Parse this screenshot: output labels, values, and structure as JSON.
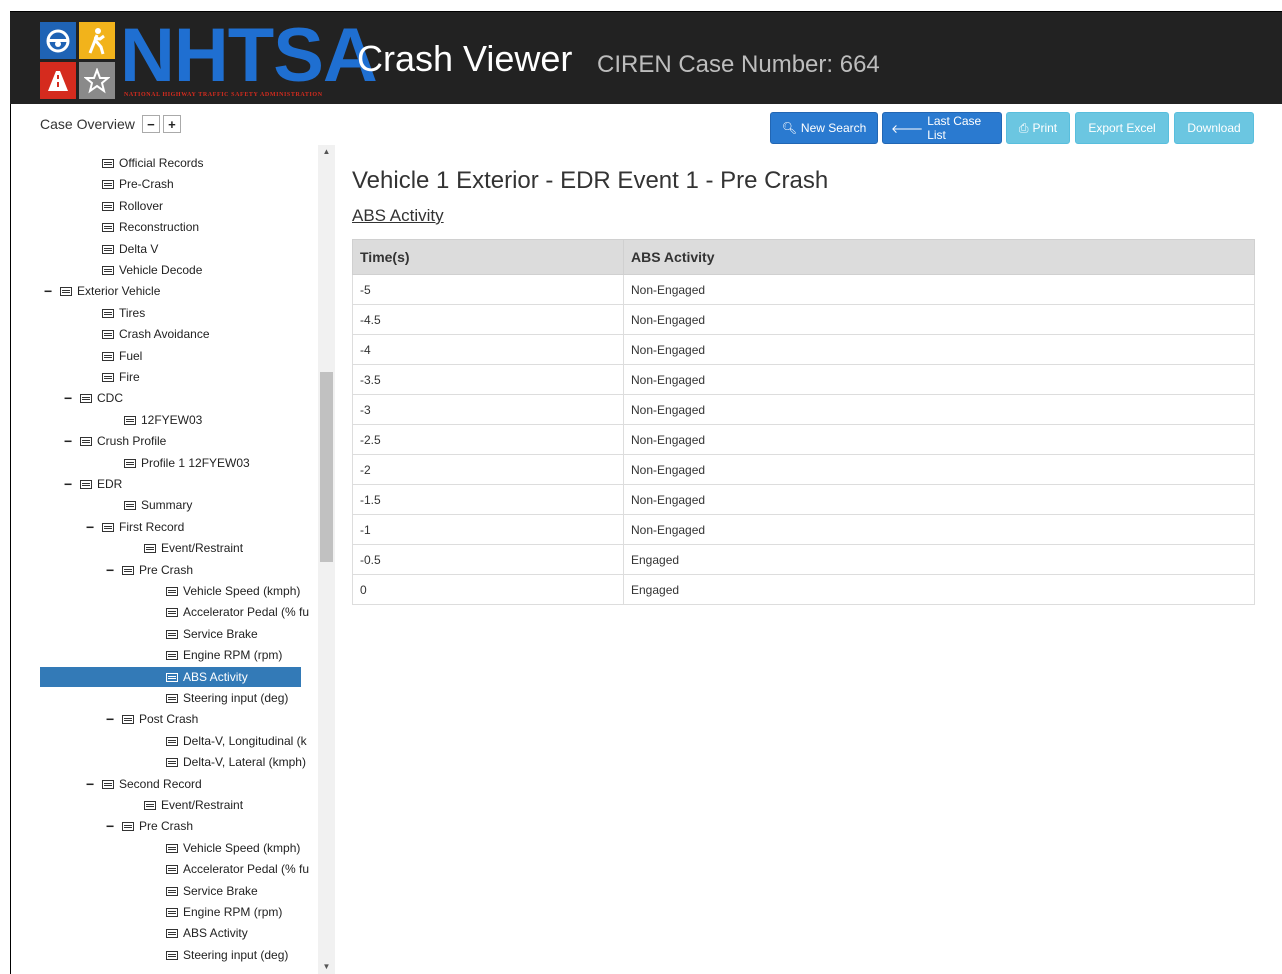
{
  "header": {
    "logo_text": "NHTSA",
    "logo_subtext": "NATIONAL HIGHWAY TRAFFIC SAFETY ADMINISTRATION",
    "app_title": "Crash Viewer",
    "case_label": "CIREN Case Number: 664"
  },
  "sidebar": {
    "title": "Case Overview",
    "collapse_label": "−",
    "expand_label": "+",
    "tree": [
      {
        "label": "Official Records",
        "toggle": ""
      },
      {
        "label": "Pre-Crash",
        "toggle": ""
      },
      {
        "label": "Rollover",
        "toggle": ""
      },
      {
        "label": "Reconstruction",
        "toggle": ""
      },
      {
        "label": "Delta V",
        "toggle": ""
      },
      {
        "label": "Vehicle Decode",
        "toggle": ""
      },
      {
        "label": "Exterior Vehicle",
        "toggle": "−"
      },
      {
        "label": "Tires",
        "toggle": ""
      },
      {
        "label": "Crash Avoidance",
        "toggle": ""
      },
      {
        "label": "Fuel",
        "toggle": ""
      },
      {
        "label": "Fire",
        "toggle": ""
      },
      {
        "label": "CDC",
        "toggle": "−"
      },
      {
        "label": "12FYEW03",
        "toggle": ""
      },
      {
        "label": "Crush Profile",
        "toggle": "−"
      },
      {
        "label": "Profile 1 12FYEW03",
        "toggle": ""
      },
      {
        "label": "EDR",
        "toggle": "−"
      },
      {
        "label": "Summary",
        "toggle": ""
      },
      {
        "label": "First Record",
        "toggle": "−"
      },
      {
        "label": "Event/Restraint",
        "toggle": ""
      },
      {
        "label": "Pre Crash",
        "toggle": "−"
      },
      {
        "label": "Vehicle Speed (kmph)",
        "toggle": ""
      },
      {
        "label": "Accelerator Pedal (% fu",
        "toggle": ""
      },
      {
        "label": "Service Brake",
        "toggle": ""
      },
      {
        "label": "Engine RPM (rpm)",
        "toggle": ""
      },
      {
        "label": "ABS Activity",
        "toggle": "",
        "selected": true
      },
      {
        "label": "Steering input (deg)",
        "toggle": ""
      },
      {
        "label": "Post Crash",
        "toggle": "−"
      },
      {
        "label": "Delta-V, Longitudinal (k",
        "toggle": ""
      },
      {
        "label": "Delta-V, Lateral (kmph)",
        "toggle": ""
      },
      {
        "label": "Second Record",
        "toggle": "−"
      },
      {
        "label": "Event/Restraint",
        "toggle": ""
      },
      {
        "label": "Pre Crash",
        "toggle": "−"
      },
      {
        "label": "Vehicle Speed (kmph)",
        "toggle": ""
      },
      {
        "label": "Accelerator Pedal (% fu",
        "toggle": ""
      },
      {
        "label": "Service Brake",
        "toggle": ""
      },
      {
        "label": "Engine RPM (rpm)",
        "toggle": ""
      },
      {
        "label": "ABS Activity",
        "toggle": ""
      },
      {
        "label": "Steering input (deg)",
        "toggle": ""
      }
    ]
  },
  "toolbar": {
    "new_search": "New Search",
    "last_case_list": "Last Case List",
    "print": "Print",
    "export_excel": "Export Excel",
    "download": "Download"
  },
  "main": {
    "title": "Vehicle 1 Exterior - EDR Event 1 - Pre Crash",
    "section": "ABS Activity",
    "table": {
      "headers": [
        "Time(s)",
        "ABS Activity"
      ],
      "rows": [
        [
          "-5",
          "Non-Engaged"
        ],
        [
          "-4.5",
          "Non-Engaged"
        ],
        [
          "-4",
          "Non-Engaged"
        ],
        [
          "-3.5",
          "Non-Engaged"
        ],
        [
          "-3",
          "Non-Engaged"
        ],
        [
          "-2.5",
          "Non-Engaged"
        ],
        [
          "-2",
          "Non-Engaged"
        ],
        [
          "-1.5",
          "Non-Engaged"
        ],
        [
          "-1",
          "Non-Engaged"
        ],
        [
          "-0.5",
          "Engaged"
        ],
        [
          "0",
          "Engaged"
        ]
      ]
    }
  },
  "colors": {
    "header_bg": "#222222",
    "logo_blue": "#1f6fd1",
    "primary_button": "#2a7ad0",
    "info_button": "#5bc0de",
    "selected_item": "#337ab7"
  }
}
